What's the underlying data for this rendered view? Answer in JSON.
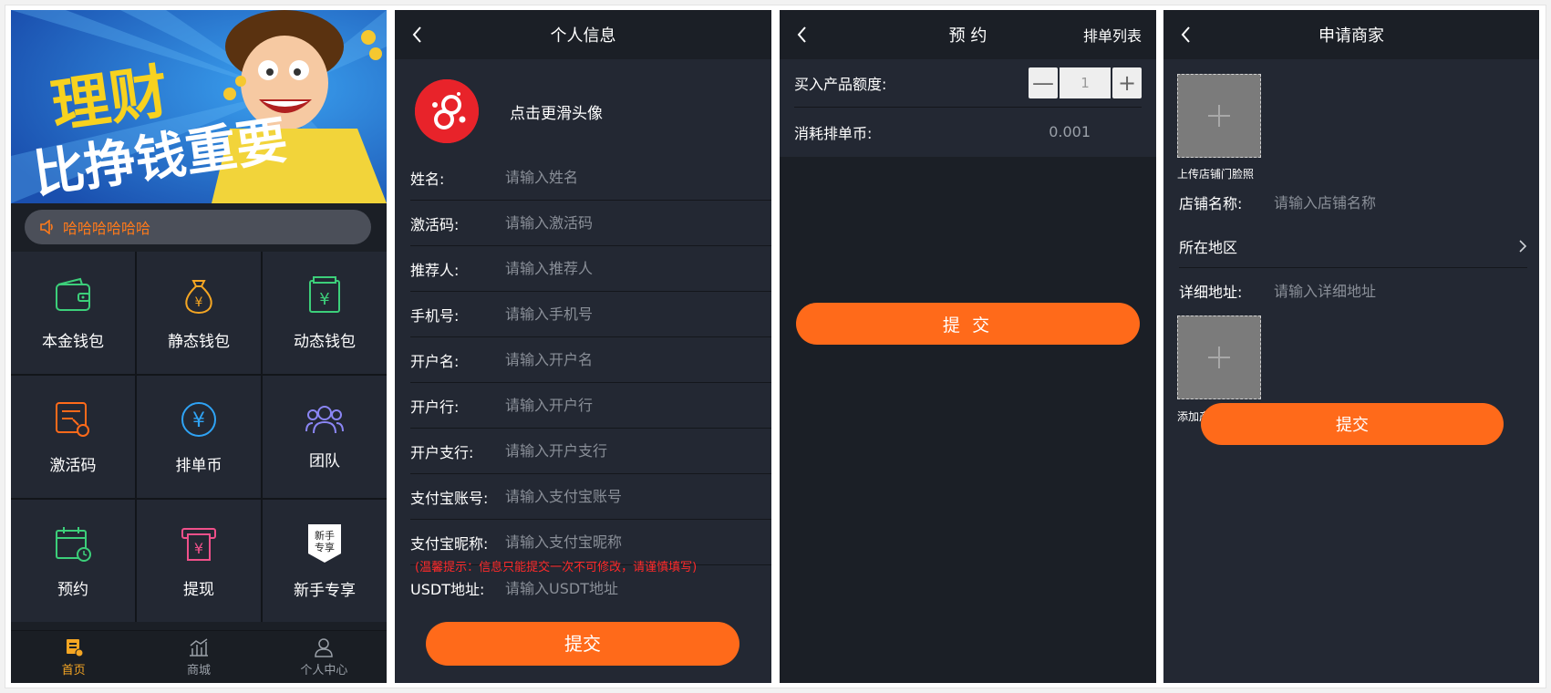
{
  "home": {
    "notice_text": "哈哈哈哈哈哈",
    "banner": {
      "line1": "理财",
      "line2": "比挣钱重要"
    },
    "grid": [
      {
        "label": "本金钱包",
        "icon": "wallet-icon",
        "color": "#3ccf7a"
      },
      {
        "label": "静态钱包",
        "icon": "money-bag-icon",
        "color": "#f5a623"
      },
      {
        "label": "动态钱包",
        "icon": "yuan-card-icon",
        "color": "#3ccf7a"
      },
      {
        "label": "激活码",
        "icon": "activation-code-icon",
        "color": "#ff6a1a"
      },
      {
        "label": "排单币",
        "icon": "yuan-coin-icon",
        "color": "#2fa3f5"
      },
      {
        "label": "团队",
        "icon": "team-icon",
        "color": "#8b86f5"
      },
      {
        "label": "预约",
        "icon": "calendar-clock-icon",
        "color": "#3ccf7a"
      },
      {
        "label": "提现",
        "icon": "withdraw-icon",
        "color": "#f0508a"
      },
      {
        "label": "新手专享",
        "icon": "newbie-badge-icon",
        "badge_text": "新手专享"
      }
    ],
    "tabs": [
      {
        "label": "首页",
        "icon": "home-icon",
        "active": true
      },
      {
        "label": "商城",
        "icon": "chart-icon",
        "active": false
      },
      {
        "label": "个人中心",
        "icon": "user-icon",
        "active": false
      }
    ]
  },
  "profile": {
    "title": "个人信息",
    "avatar_label": "点击更滑头像",
    "fields": [
      {
        "label": "姓名:",
        "placeholder": "请输入姓名"
      },
      {
        "label": "激活码:",
        "placeholder": "请输入激活码"
      },
      {
        "label": "推荐人:",
        "placeholder": "请输入推荐人"
      },
      {
        "label": "手机号:",
        "placeholder": "请输入手机号"
      },
      {
        "label": "开户名:",
        "placeholder": "请输入开户名"
      },
      {
        "label": "开户行:",
        "placeholder": "请输入开户行"
      },
      {
        "label": "开户支行:",
        "placeholder": "请输入开户支行"
      },
      {
        "label": "支付宝账号:",
        "placeholder": "请输入支付宝账号"
      },
      {
        "label": "支付宝昵称:",
        "placeholder": "请输入支付宝昵称"
      },
      {
        "label": "USDT地址:",
        "placeholder": "请输入USDT地址"
      }
    ],
    "warning": "(温馨提示：信息只能提交一次不可修改，请谨慎填写)",
    "submit_label": "提交"
  },
  "reserve": {
    "title": "预 约",
    "right_link": "排单列表",
    "amount_label": "买入产品额度:",
    "minus": "—",
    "quantity": "1",
    "plus": "+",
    "cost_label": "消耗排单币:",
    "cost_value": "0.001",
    "submit_label": "提 交"
  },
  "merchant": {
    "title": "申请商家",
    "upload_store_label": "上传店铺门脸照",
    "store_name_label": "店铺名称:",
    "store_name_placeholder": "请输入店铺名称",
    "region_label": "所在地区",
    "address_label": "详细地址:",
    "address_placeholder": "请输入详细地址",
    "upload_product_label": "添加产品图片",
    "submit_label": "提交"
  },
  "colors": {
    "accent": "#ff6a1a",
    "bg": "#1b1f26",
    "panel": "#232833",
    "active_tab": "#f5a623"
  }
}
